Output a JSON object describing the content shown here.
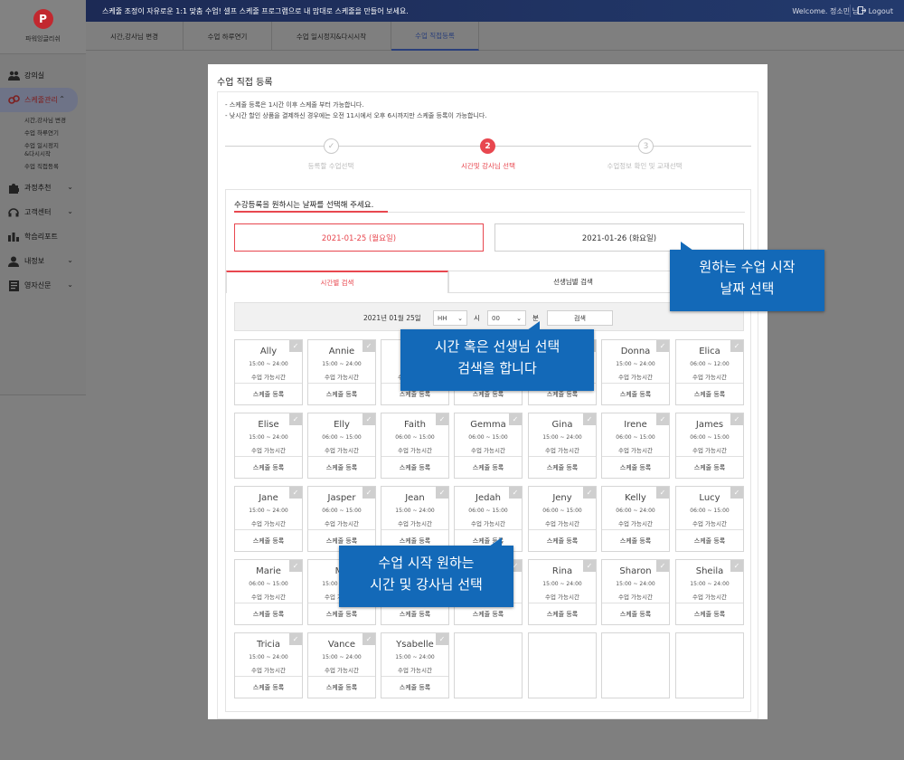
{
  "topbar": {
    "notice": "스케줄 조정이 자유로운 1:1 맞춤 수업! 셀프 스케줄 프로그램으로 내 맘대로 스케줄을 만들어 보세요.",
    "welcome": "Welcome. 정소민 님",
    "logout": "Logout"
  },
  "sidebar": {
    "logo_letter": "P",
    "logo_text": "파워잉글리쉬",
    "items": [
      {
        "label": "강의실",
        "icon": "people-icon"
      },
      {
        "label": "스케줄관리",
        "icon": "link-icon"
      },
      {
        "label": "과정추천",
        "icon": "puzzle-icon"
      },
      {
        "label": "고객센터",
        "icon": "headset-icon"
      },
      {
        "label": "학습리포트",
        "icon": "chart-icon"
      },
      {
        "label": "내정보",
        "icon": "user-icon"
      },
      {
        "label": "영자신문",
        "icon": "newspaper-icon"
      }
    ],
    "sub_items": [
      "시간,강사님 변경",
      "수업 하루연기",
      "수업 일시정지 &다시시작",
      "수업 직접등록"
    ]
  },
  "tabs": [
    "시간,강사님 변경",
    "수업 하루연기",
    "수업 일시정지&다시시작",
    "수업 직접등록"
  ],
  "modal": {
    "title": "수업 직접 등록",
    "notes": [
      "- 스케줄 등록은 1시간 이후 스케줄 부터 가능합니다.",
      "- 낮시간 할인 상품을 결제하신 경우에는 오전 11시에서 오후 6시까지만 스케줄 등록이 가능합니다."
    ],
    "steps": [
      {
        "num": "✓",
        "label": "등록할 수업선택"
      },
      {
        "num": "2",
        "label": "시간및 강사님 선택"
      },
      {
        "num": "3",
        "label": "수업정보 확인 및 교재선택"
      }
    ],
    "date_heading": "수강등록을 원하시는 날짜를 선택해 주세요.",
    "dates": [
      "2021-01-25 (월요일)",
      "2021-01-26 (화요일)"
    ],
    "search_tabs": [
      "시간별 검색",
      "선생님별 검색"
    ],
    "search": {
      "date": "2021년 01월 25일",
      "hour": "HH",
      "hour_unit": "시",
      "minute": "00",
      "minute_unit": "분",
      "button": "검색"
    },
    "teachers": [
      {
        "name": "Ally",
        "time": "15:00 ~ 24:00"
      },
      {
        "name": "Annie",
        "time": "15:00 ~ 24:00"
      },
      {
        "name": "",
        "time": ""
      },
      {
        "name": "",
        "time": ""
      },
      {
        "name": "",
        "time": ""
      },
      {
        "name": "Donna",
        "time": "15:00 ~ 24:00"
      },
      {
        "name": "Elica",
        "time": "06:00 ~ 12:00"
      },
      {
        "name": "Elise",
        "time": "15:00 ~ 24:00"
      },
      {
        "name": "Elly",
        "time": "06:00 ~ 15:00"
      },
      {
        "name": "Faith",
        "time": "06:00 ~ 15:00"
      },
      {
        "name": "Gemma",
        "time": "06:00 ~ 15:00"
      },
      {
        "name": "Gina",
        "time": "15:00 ~ 24:00"
      },
      {
        "name": "Irene",
        "time": "06:00 ~ 15:00"
      },
      {
        "name": "James",
        "time": "06:00 ~ 15:00"
      },
      {
        "name": "Jane",
        "time": "15:00 ~ 24:00"
      },
      {
        "name": "Jasper",
        "time": "06:00 ~ 15:00"
      },
      {
        "name": "Jean",
        "time": "15:00 ~ 24:00"
      },
      {
        "name": "Jedah",
        "time": "06:00 ~ 15:00"
      },
      {
        "name": "Jeny",
        "time": "06:00 ~ 15:00"
      },
      {
        "name": "Kelly",
        "time": "06:00 ~ 24:00"
      },
      {
        "name": "Lucy",
        "time": "06:00 ~ 15:00"
      },
      {
        "name": "Marie",
        "time": "06:00 ~ 15:00"
      },
      {
        "name": "Ma",
        "time": "15:00 ~ 24:00"
      },
      {
        "name": "",
        "time": ""
      },
      {
        "name": "",
        "time": ""
      },
      {
        "name": "Rina",
        "time": "15:00 ~ 24:00"
      },
      {
        "name": "Sharon",
        "time": "15:00 ~ 24:00"
      },
      {
        "name": "Sheila",
        "time": "15:00 ~ 24:00"
      },
      {
        "name": "Tricia",
        "time": "15:00 ~ 24:00"
      },
      {
        "name": "Vance",
        "time": "15:00 ~ 24:00"
      },
      {
        "name": "Ysabelle",
        "time": "15:00 ~ 24:00"
      }
    ],
    "avail_label": "수업 가능시간",
    "register_label": "스케줄 등록"
  },
  "callouts": {
    "date": [
      "원하는 수업 시작",
      "날짜 선택"
    ],
    "search": [
      "시간 혹은 선생님 선택",
      "검색을 합니다"
    ],
    "teacher": [
      "수업 시작 원하는",
      "시간 및 강사님 선택"
    ]
  }
}
